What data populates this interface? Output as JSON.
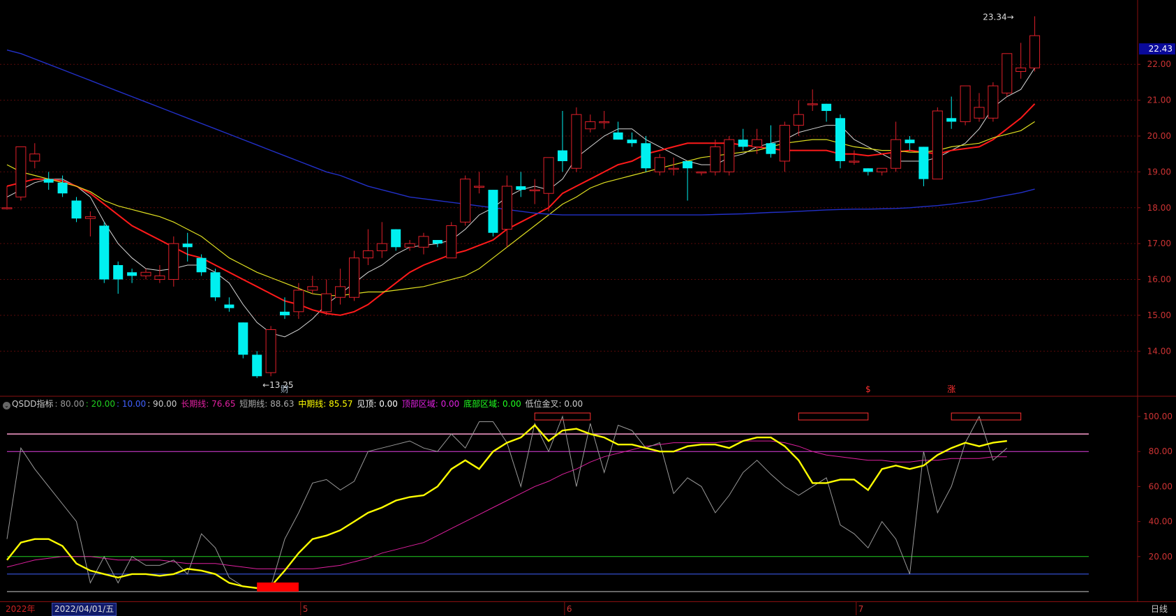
{
  "colors": {
    "up": "#e0202a",
    "down": "#00f0f0",
    "ma5": "#d8d8d8",
    "ma10": "#ff1a1a",
    "ma20": "#e0e020",
    "ma60": "#2230c8",
    "grid": "#5a0a0a",
    "axis": "#8a1010",
    "long": "#e020a0",
    "short": "#9a9a9a",
    "mid": "#ffff00",
    "line80": "#e040e0",
    "line20": "#20d020",
    "line10": "#4060ff",
    "line90": "#ff9fcf"
  },
  "chart_data": [
    {
      "type": "candlestick",
      "name": "price",
      "ylim": [
        12.8,
        23.6
      ],
      "y_ticks": [
        14.0,
        15.0,
        16.0,
        17.0,
        18.0,
        19.0,
        20.0,
        21.0,
        22.0
      ],
      "tick_labels": [
        "14.00",
        "15.00",
        "16.00",
        "17.00",
        "18.00",
        "19.00",
        "20.00",
        "21.00",
        "22.00"
      ],
      "last_price": 22.43,
      "last_price_label": "22.43",
      "annotations": [
        {
          "text": "13.25",
          "index": 19,
          "value": 13.25,
          "type": "low"
        },
        {
          "text": "23.34",
          "index": 73,
          "value": 23.34,
          "type": "high"
        }
      ],
      "event_markers": [
        {
          "text": "财",
          "index": 20
        },
        {
          "text": "$",
          "index": 62
        },
        {
          "text": "涨",
          "index": 68
        }
      ],
      "ohlc": [
        [
          18.0,
          18.0,
          17.95,
          18.6
        ],
        [
          18.3,
          19.7,
          18.2,
          19.7
        ],
        [
          19.3,
          19.5,
          19.1,
          19.8
        ],
        [
          18.8,
          18.7,
          18.5,
          19.0
        ],
        [
          18.7,
          18.4,
          18.3,
          18.9
        ],
        [
          18.2,
          17.7,
          17.6,
          18.3
        ],
        [
          17.7,
          17.75,
          17.2,
          17.9
        ],
        [
          17.5,
          16.0,
          15.9,
          17.6
        ],
        [
          16.4,
          16.0,
          15.6,
          16.5
        ],
        [
          16.2,
          16.1,
          15.9,
          16.3
        ],
        [
          16.1,
          16.2,
          16.0,
          16.3
        ],
        [
          16.0,
          16.1,
          15.9,
          16.4
        ],
        [
          16.0,
          17.0,
          15.8,
          17.2
        ],
        [
          17.0,
          16.9,
          16.5,
          17.3
        ],
        [
          16.6,
          16.2,
          16.1,
          16.7
        ],
        [
          16.2,
          15.5,
          15.4,
          16.3
        ],
        [
          15.3,
          15.2,
          15.1,
          15.5
        ],
        [
          14.8,
          13.9,
          13.8,
          14.8
        ],
        [
          13.9,
          13.3,
          13.25,
          14.0
        ],
        [
          13.4,
          14.6,
          13.3,
          14.7
        ],
        [
          15.1,
          15.0,
          14.9,
          15.5
        ],
        [
          15.1,
          15.7,
          14.9,
          15.9
        ],
        [
          15.7,
          15.8,
          15.6,
          16.1
        ],
        [
          15.1,
          15.6,
          15.0,
          16.0
        ],
        [
          15.5,
          15.8,
          15.3,
          16.3
        ],
        [
          15.5,
          16.6,
          15.4,
          16.8
        ],
        [
          16.6,
          16.8,
          16.4,
          17.4
        ],
        [
          16.8,
          17.0,
          16.6,
          17.6
        ],
        [
          17.4,
          16.9,
          16.8,
          17.4
        ],
        [
          16.9,
          17.0,
          16.8,
          17.1
        ],
        [
          16.9,
          17.2,
          16.7,
          17.3
        ],
        [
          17.1,
          17.0,
          16.9,
          17.1
        ],
        [
          16.6,
          17.5,
          16.6,
          17.6
        ],
        [
          17.6,
          18.8,
          17.5,
          18.9
        ],
        [
          18.6,
          18.6,
          18.4,
          19.0
        ],
        [
          18.5,
          17.3,
          17.2,
          18.5
        ],
        [
          17.4,
          18.6,
          16.9,
          18.9
        ],
        [
          18.6,
          18.5,
          18.3,
          19.0
        ],
        [
          18.5,
          18.5,
          18.1,
          18.8
        ],
        [
          18.4,
          19.4,
          17.9,
          19.4
        ],
        [
          19.6,
          19.3,
          19.0,
          20.7
        ],
        [
          19.1,
          20.6,
          19.0,
          20.8
        ],
        [
          20.2,
          20.4,
          20.1,
          20.6
        ],
        [
          20.4,
          20.4,
          20.2,
          20.7
        ],
        [
          20.1,
          19.9,
          19.9,
          20.4
        ],
        [
          19.9,
          19.8,
          19.7,
          20.1
        ],
        [
          19.8,
          19.1,
          19.0,
          20.0
        ],
        [
          19.0,
          19.4,
          18.9,
          19.5
        ],
        [
          19.1,
          19.1,
          18.9,
          19.4
        ],
        [
          19.3,
          19.1,
          18.2,
          19.3
        ],
        [
          19.0,
          19.0,
          18.9,
          19.0
        ],
        [
          19.0,
          19.7,
          18.9,
          19.9
        ],
        [
          19.0,
          19.9,
          18.9,
          20.0
        ],
        [
          19.9,
          19.7,
          19.6,
          20.2
        ],
        [
          19.7,
          19.9,
          19.5,
          20.2
        ],
        [
          19.8,
          19.5,
          19.4,
          20.3
        ],
        [
          19.3,
          20.3,
          19.0,
          20.4
        ],
        [
          20.3,
          20.6,
          20.0,
          21.0
        ],
        [
          20.9,
          20.9,
          20.7,
          21.3
        ],
        [
          20.9,
          20.7,
          20.4,
          20.9
        ],
        [
          20.5,
          19.3,
          19.1,
          20.6
        ],
        [
          19.3,
          19.3,
          19.2,
          19.6
        ],
        [
          19.1,
          19.0,
          18.9,
          19.1
        ],
        [
          19.0,
          19.1,
          18.9,
          19.1
        ],
        [
          19.1,
          19.9,
          19.0,
          20.4
        ],
        [
          19.9,
          19.8,
          19.6,
          20.0
        ],
        [
          19.7,
          18.8,
          18.6,
          19.7
        ],
        [
          18.8,
          20.7,
          18.8,
          20.8
        ],
        [
          20.5,
          20.4,
          20.2,
          21.1
        ],
        [
          20.4,
          21.4,
          20.3,
          21.3
        ],
        [
          20.5,
          20.8,
          20.4,
          21.2
        ],
        [
          20.5,
          21.4,
          20.4,
          21.5
        ],
        [
          21.2,
          22.3,
          21.1,
          22.3
        ],
        [
          21.8,
          21.9,
          21.6,
          22.6
        ],
        [
          21.9,
          22.8,
          21.8,
          23.34
        ]
      ],
      "ma_series": [
        {
          "name": "MA5",
          "values": [
            18.3,
            18.5,
            18.7,
            18.8,
            18.8,
            18.6,
            18.3,
            17.6,
            17.0,
            16.6,
            16.3,
            16.25,
            16.3,
            16.4,
            16.4,
            16.2,
            15.9,
            15.3,
            14.8,
            14.5,
            14.4,
            14.6,
            14.9,
            15.3,
            15.6,
            15.9,
            16.2,
            16.4,
            16.7,
            16.9,
            16.95,
            17.0,
            17.1,
            17.4,
            17.8,
            18.0,
            18.3,
            18.5,
            18.6,
            18.5,
            18.8,
            19.4,
            19.7,
            20.0,
            20.2,
            20.2,
            19.9,
            19.7,
            19.5,
            19.3,
            19.2,
            19.2,
            19.4,
            19.5,
            19.7,
            19.8,
            19.9,
            20.1,
            20.2,
            20.3,
            20.3,
            19.9,
            19.7,
            19.5,
            19.3,
            19.3,
            19.3,
            19.4,
            19.6,
            19.8,
            20.2,
            20.8,
            21.1,
            21.3,
            21.9
          ]
        },
        {
          "name": "MA10",
          "values": [
            18.6,
            18.7,
            18.8,
            18.8,
            18.75,
            18.6,
            18.4,
            18.1,
            17.8,
            17.5,
            17.3,
            17.1,
            16.9,
            16.7,
            16.6,
            16.4,
            16.2,
            16.0,
            15.8,
            15.6,
            15.4,
            15.3,
            15.15,
            15.05,
            15.0,
            15.1,
            15.3,
            15.6,
            15.9,
            16.2,
            16.4,
            16.55,
            16.7,
            16.8,
            16.95,
            17.1,
            17.4,
            17.6,
            17.8,
            18.0,
            18.4,
            18.6,
            18.8,
            19.0,
            19.2,
            19.3,
            19.5,
            19.6,
            19.7,
            19.8,
            19.8,
            19.8,
            19.8,
            19.75,
            19.7,
            19.65,
            19.6,
            19.6,
            19.6,
            19.6,
            19.5,
            19.5,
            19.45,
            19.5,
            19.55,
            19.6,
            19.55,
            19.5,
            19.6,
            19.65,
            19.7,
            19.9,
            20.2,
            20.5,
            20.9
          ]
        },
        {
          "name": "MA20",
          "values": [
            19.2,
            19.0,
            18.9,
            18.8,
            18.7,
            18.6,
            18.45,
            18.2,
            18.05,
            17.95,
            17.85,
            17.75,
            17.6,
            17.4,
            17.2,
            16.9,
            16.6,
            16.4,
            16.2,
            16.05,
            15.9,
            15.75,
            15.6,
            15.55,
            15.55,
            15.6,
            15.65,
            15.65,
            15.7,
            15.75,
            15.8,
            15.9,
            16.0,
            16.1,
            16.3,
            16.6,
            16.9,
            17.2,
            17.5,
            17.8,
            18.1,
            18.3,
            18.55,
            18.7,
            18.8,
            18.9,
            19.0,
            19.1,
            19.2,
            19.3,
            19.4,
            19.45,
            19.5,
            19.55,
            19.6,
            19.7,
            19.8,
            19.85,
            19.9,
            19.9,
            19.8,
            19.7,
            19.65,
            19.6,
            19.6,
            19.55,
            19.55,
            19.6,
            19.7,
            19.75,
            19.8,
            19.95,
            20.05,
            20.15,
            20.4
          ]
        },
        {
          "name": "MA60",
          "values": [
            22.4,
            22.3,
            22.15,
            22.0,
            21.85,
            21.7,
            21.55,
            21.4,
            21.25,
            21.1,
            20.95,
            20.8,
            20.65,
            20.5,
            20.35,
            20.2,
            20.05,
            19.9,
            19.75,
            19.6,
            19.45,
            19.3,
            19.15,
            19.0,
            18.9,
            18.75,
            18.6,
            18.5,
            18.4,
            18.3,
            18.25,
            18.2,
            18.15,
            18.1,
            18.05,
            18.0,
            17.95,
            17.9,
            17.85,
            17.82,
            17.8,
            17.8,
            17.8,
            17.8,
            17.8,
            17.8,
            17.8,
            17.8,
            17.8,
            17.8,
            17.8,
            17.81,
            17.82,
            17.83,
            17.85,
            17.87,
            17.88,
            17.9,
            17.92,
            17.94,
            17.95,
            17.96,
            17.96,
            17.97,
            17.98,
            18.0,
            18.03,
            18.06,
            18.1,
            18.15,
            18.2,
            18.28,
            18.35,
            18.42,
            18.52
          ]
        }
      ]
    },
    {
      "type": "line",
      "name": "QSDD指标",
      "ylim": [
        0,
        110
      ],
      "y_ticks": [
        20,
        40,
        60,
        80,
        100
      ],
      "tick_labels": [
        "20.00",
        "40.00",
        "60.00",
        "80.00",
        "100.00"
      ],
      "header": [
        {
          "text": "QSDD指标",
          "color": "#cccccc"
        },
        {
          "text": ": 80.00",
          "color": "#999999"
        },
        {
          "text": ": 20.00",
          "color": "#20d020"
        },
        {
          "text": ": 10.00",
          "color": "#4060ff"
        },
        {
          "text": ": 90.00",
          "color": "#cccccc"
        },
        {
          "text": " 长期线: 76.65",
          "color": "#e020a0"
        },
        {
          "text": " 短期线: 88.63",
          "color": "#aaaaaa"
        },
        {
          "text": " 中期线: 85.57",
          "color": "#ffff00"
        },
        {
          "text": " 见顶: 0.00",
          "color": "#ffffff"
        },
        {
          "text": " 顶部区域: 0.00",
          "color": "#e020e0"
        },
        {
          "text": " 底部区域: 0.00",
          "color": "#20ff20"
        },
        {
          "text": "   低位金叉: 0.00",
          "color": "#cccccc"
        }
      ],
      "h_lines": [
        {
          "value": 90,
          "color": "#ff9fcf"
        },
        {
          "value": 80,
          "color": "#e040e0"
        },
        {
          "value": 20,
          "color": "#20d020"
        },
        {
          "value": 10,
          "color": "#4060ff"
        },
        {
          "value": 0,
          "color": "#cccccc"
        }
      ],
      "series": [
        {
          "name": "短期线",
          "color": "#9a9a9a",
          "values": [
            30,
            82,
            70,
            60,
            50,
            40,
            5,
            20,
            5,
            20,
            15,
            15,
            18,
            10,
            33,
            25,
            8,
            3,
            2,
            3,
            30,
            45,
            62,
            64,
            58,
            63,
            80,
            82,
            84,
            86,
            82,
            80,
            90,
            82,
            97,
            97,
            85,
            60,
            96,
            80,
            100,
            60,
            96,
            68,
            95,
            92,
            82,
            85,
            56,
            65,
            60,
            45,
            55,
            68,
            75,
            67,
            60,
            55,
            60,
            65,
            38,
            33,
            25,
            40,
            30,
            10,
            80,
            45,
            60,
            85,
            100,
            75,
            82
          ]
        },
        {
          "name": "中期线",
          "color": "#ffff00",
          "values": [
            18,
            28,
            30,
            30,
            26,
            16,
            12,
            10,
            8,
            10,
            10,
            9,
            10,
            13,
            12,
            10,
            5,
            3,
            2,
            3,
            12,
            22,
            30,
            32,
            35,
            40,
            45,
            48,
            52,
            54,
            55,
            60,
            70,
            75,
            70,
            80,
            85,
            88,
            95,
            86,
            92,
            93,
            90,
            88,
            84,
            84,
            82,
            80,
            80,
            83,
            84,
            84,
            82,
            86,
            88,
            88,
            83,
            75,
            62,
            62,
            64,
            64,
            58,
            70,
            72,
            70,
            72,
            78,
            82,
            85,
            83,
            85,
            86
          ]
        },
        {
          "name": "长期线",
          "color": "#e020a0",
          "values": [
            14,
            16,
            18,
            19,
            20,
            20,
            20,
            19,
            18,
            18,
            18,
            18,
            17,
            16,
            16,
            16,
            15,
            14,
            13,
            13,
            13,
            13,
            13,
            14,
            15,
            17,
            19,
            22,
            24,
            26,
            28,
            32,
            36,
            40,
            44,
            48,
            52,
            56,
            60,
            63,
            67,
            70,
            74,
            77,
            79,
            81,
            83,
            84,
            85,
            85,
            85,
            85,
            86,
            86,
            86,
            86,
            85,
            83,
            80,
            78,
            77,
            76,
            75,
            75,
            74,
            74,
            75,
            75,
            76,
            76,
            76,
            77,
            77
          ]
        }
      ],
      "signals": [
        {
          "type": "bottom-area",
          "index_start": 18,
          "index_end": 21,
          "color": "#ff0000"
        },
        {
          "type": "top-area",
          "index_start": 38,
          "index_end": 42,
          "color": "#ff3030"
        },
        {
          "type": "top-area",
          "index_start": 57,
          "index_end": 62,
          "color": "#ff3030"
        },
        {
          "type": "top-area",
          "index_start": 68,
          "index_end": 73,
          "color": "#ff3030"
        }
      ]
    }
  ],
  "bottom_bar": {
    "year": "2022年",
    "date": "2022/04/01/五",
    "months": [
      {
        "label": "5",
        "index": 22
      },
      {
        "label": "6",
        "index": 41
      },
      {
        "label": "7",
        "index": 62
      }
    ],
    "period": "日线"
  }
}
